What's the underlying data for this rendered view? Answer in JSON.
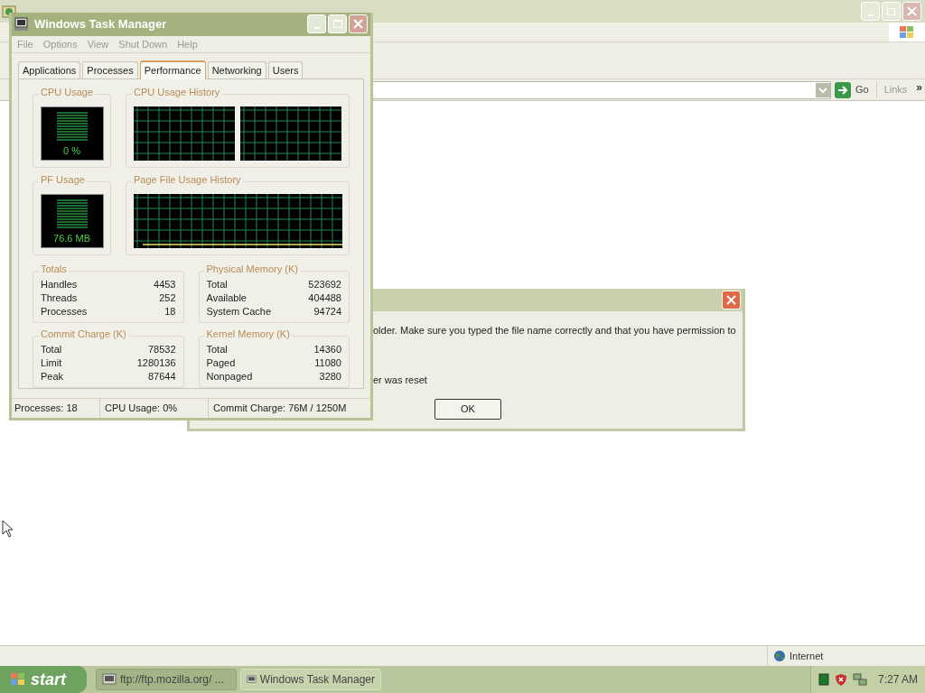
{
  "browser": {
    "go": "Go",
    "links": "Links",
    "chevron": "»",
    "status": "Internet"
  },
  "dialog": {
    "lines": [
      "older. Make sure you typed the file name correctly and that you have permission to",
      "er was reset"
    ],
    "button": "OK"
  },
  "task_manager": {
    "title": "Windows Task Manager",
    "menu": [
      "File",
      "Options",
      "View",
      "Shut Down",
      "Help"
    ],
    "tabs": [
      {
        "label": "Applications",
        "selected": false
      },
      {
        "label": "Processes",
        "selected": false
      },
      {
        "label": "Performance",
        "selected": true
      },
      {
        "label": "Networking",
        "selected": false
      },
      {
        "label": "Users",
        "selected": false
      }
    ],
    "cpu_usage": {
      "label": "CPU Usage",
      "reading": "0 %"
    },
    "cpu_history": {
      "label": "CPU Usage History"
    },
    "pf_usage": {
      "label": "PF Usage",
      "reading": "76.6 MB"
    },
    "pf_history": {
      "label": "Page File Usage History"
    },
    "groups": [
      {
        "title": "Totals",
        "rows": [
          {
            "label": "Handles",
            "value": "4453"
          },
          {
            "label": "Threads",
            "value": "252"
          },
          {
            "label": "Processes",
            "value": "18"
          }
        ]
      },
      {
        "title": "Physical Memory (K)",
        "rows": [
          {
            "label": "Total",
            "value": "523692"
          },
          {
            "label": "Available",
            "value": "404488"
          },
          {
            "label": "System Cache",
            "value": "94724"
          }
        ]
      },
      {
        "title": "Commit Charge (K)",
        "rows": [
          {
            "label": "Total",
            "value": "78532"
          },
          {
            "label": "Limit",
            "value": "1280136"
          },
          {
            "label": "Peak",
            "value": "87644"
          }
        ]
      },
      {
        "title": "Kernel Memory (K)",
        "rows": [
          {
            "label": "Total",
            "value": "14360"
          },
          {
            "label": "Paged",
            "value": "11080"
          },
          {
            "label": "Nonpaged",
            "value": "3280"
          }
        ]
      }
    ],
    "status": [
      "Processes: 18",
      "CPU Usage: 0%",
      "Commit Charge: 76M / 1250M"
    ]
  },
  "taskbar": {
    "start": "start",
    "tasks": [
      {
        "label": "ftp://ftp.mozilla.org/ ...",
        "selected": false
      },
      {
        "label": "Windows Task Manager",
        "selected": true
      }
    ],
    "clock": "7:27 AM"
  }
}
